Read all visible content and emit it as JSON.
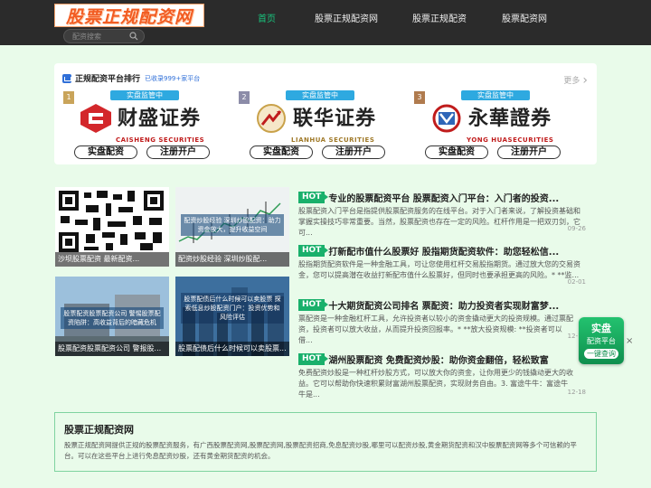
{
  "header": {
    "logo_text": "股票正规配资网",
    "search_placeholder": "配资搜索",
    "nav": [
      "首页",
      "股票正规配资网",
      "股票正规配资",
      "股票配资网"
    ],
    "active_color": "#19c37d"
  },
  "rank": {
    "title": "正规配资平台排行",
    "subtitle": "已收录999+家平台",
    "more": "更多",
    "ribbon": "实盘监管中",
    "button_primary": "实盘配资",
    "button_secondary": "注册开户",
    "brokers": [
      {
        "rank": "1",
        "name": "财盛证券",
        "en": "CAISHENG SECURITIES"
      },
      {
        "rank": "2",
        "name": "联华证券",
        "en": "LIANHUA SECURITIES"
      },
      {
        "rank": "3",
        "name": "永華證券",
        "en": "YONG HUASECURITIES"
      }
    ]
  },
  "tiles": [
    {
      "caption": "沙坝股票配资 最新配资...",
      "overlay": ""
    },
    {
      "caption": "配资炒股经验 深圳炒股配...",
      "overlay": "配资炒股经验 深圳炒股配资：助力资金放大，提升收益空间"
    },
    {
      "caption": "股票配资股票配资公司 警报股...",
      "overlay": "股票配资股票配资公司 警惕股票配资陷阱：高收益背后的暗藏危机"
    },
    {
      "caption": "股票配债后什么时候可以卖股票...",
      "overlay": "股票配债后什么时候可以卖股票 探索低息炒股配资门户：投资优势和风险评估"
    }
  ],
  "news": [
    {
      "title": "专业的股票配资平台 股票配资入门平台：入门者的投资...",
      "desc": "股票配资入门平台是指提供股票配资服务的在线平台。对于入门者来说，了解投资基础和掌握实操技巧非常重要。当然，股票配资也存在一定的风险。杠杆作用是一把双刃剑，它可...",
      "date": "09-26"
    },
    {
      "title": "打新配市值什么股票好 股指期货配资软件：助您轻松信...",
      "desc": "股指期货配资软件是一种金融工具，可让您使用杠杆交易股指期货。通过放大您的交易资金，您可以提高潜在收益打新配市值什么股票好，但同时也要承担更高的风险。* **监...",
      "date": "02-01"
    },
    {
      "title": "十大期货配资公司排名 票配资：助力投资者实现财富梦...",
      "desc": "票配资是一种金融杠杆工具，允许投资者以较小的资金撬动更大的投资规模。通过票配资，投资者可以放大收益，从而提升投资回报率。* **放大投资规模: **投资者可以借...",
      "date": "12-18"
    },
    {
      "title": "湖州股票配资 免费配资炒股：助你资金翻倍，轻松致富",
      "desc": "免费配资炒股是一种杠杆炒股方式，可以放大你的资金，让你用更少的钱撬动更大的收益。它可以帮助你快速积累财富湖州股票配资，实现财务自由。3. 富途牛牛：富途牛牛是...",
      "date": "12-18"
    }
  ],
  "float_ad": {
    "line1": "实盘",
    "line2": "配资平台",
    "line3": "一键查询",
    "close": "×"
  },
  "about": {
    "title": "股票正规配资网",
    "text": "股票正规配资网提供正规的股票配资服务，有广西股票配资网,股票配资网,股票配资招商,免息配资炒股,哪里可以配资炒股,黄金期货配资和汉中股票配资网等多个可信赖的平台。可以在这些平台上进行免息配资炒股，还有黄金期货配资的机会。"
  }
}
